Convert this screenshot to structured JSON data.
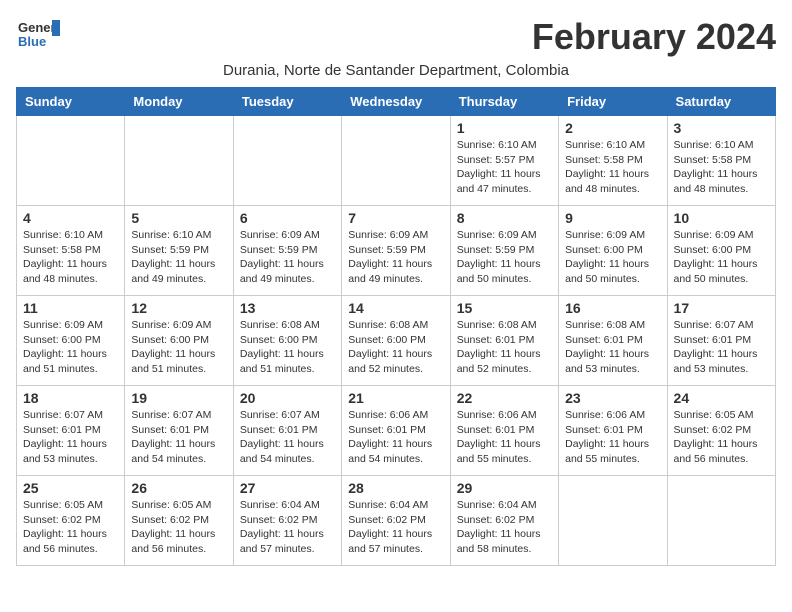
{
  "logo": {
    "general": "General",
    "blue": "Blue"
  },
  "title": "February 2024",
  "subtitle": "Durania, Norte de Santander Department, Colombia",
  "days_of_week": [
    "Sunday",
    "Monday",
    "Tuesday",
    "Wednesday",
    "Thursday",
    "Friday",
    "Saturday"
  ],
  "weeks": [
    [
      {
        "day": "",
        "info": ""
      },
      {
        "day": "",
        "info": ""
      },
      {
        "day": "",
        "info": ""
      },
      {
        "day": "",
        "info": ""
      },
      {
        "day": "1",
        "info": "Sunrise: 6:10 AM\nSunset: 5:57 PM\nDaylight: 11 hours and 47 minutes."
      },
      {
        "day": "2",
        "info": "Sunrise: 6:10 AM\nSunset: 5:58 PM\nDaylight: 11 hours and 48 minutes."
      },
      {
        "day": "3",
        "info": "Sunrise: 6:10 AM\nSunset: 5:58 PM\nDaylight: 11 hours and 48 minutes."
      }
    ],
    [
      {
        "day": "4",
        "info": "Sunrise: 6:10 AM\nSunset: 5:58 PM\nDaylight: 11 hours and 48 minutes."
      },
      {
        "day": "5",
        "info": "Sunrise: 6:10 AM\nSunset: 5:59 PM\nDaylight: 11 hours and 49 minutes."
      },
      {
        "day": "6",
        "info": "Sunrise: 6:09 AM\nSunset: 5:59 PM\nDaylight: 11 hours and 49 minutes."
      },
      {
        "day": "7",
        "info": "Sunrise: 6:09 AM\nSunset: 5:59 PM\nDaylight: 11 hours and 49 minutes."
      },
      {
        "day": "8",
        "info": "Sunrise: 6:09 AM\nSunset: 5:59 PM\nDaylight: 11 hours and 50 minutes."
      },
      {
        "day": "9",
        "info": "Sunrise: 6:09 AM\nSunset: 6:00 PM\nDaylight: 11 hours and 50 minutes."
      },
      {
        "day": "10",
        "info": "Sunrise: 6:09 AM\nSunset: 6:00 PM\nDaylight: 11 hours and 50 minutes."
      }
    ],
    [
      {
        "day": "11",
        "info": "Sunrise: 6:09 AM\nSunset: 6:00 PM\nDaylight: 11 hours and 51 minutes."
      },
      {
        "day": "12",
        "info": "Sunrise: 6:09 AM\nSunset: 6:00 PM\nDaylight: 11 hours and 51 minutes."
      },
      {
        "day": "13",
        "info": "Sunrise: 6:08 AM\nSunset: 6:00 PM\nDaylight: 11 hours and 51 minutes."
      },
      {
        "day": "14",
        "info": "Sunrise: 6:08 AM\nSunset: 6:00 PM\nDaylight: 11 hours and 52 minutes."
      },
      {
        "day": "15",
        "info": "Sunrise: 6:08 AM\nSunset: 6:01 PM\nDaylight: 11 hours and 52 minutes."
      },
      {
        "day": "16",
        "info": "Sunrise: 6:08 AM\nSunset: 6:01 PM\nDaylight: 11 hours and 53 minutes."
      },
      {
        "day": "17",
        "info": "Sunrise: 6:07 AM\nSunset: 6:01 PM\nDaylight: 11 hours and 53 minutes."
      }
    ],
    [
      {
        "day": "18",
        "info": "Sunrise: 6:07 AM\nSunset: 6:01 PM\nDaylight: 11 hours and 53 minutes."
      },
      {
        "day": "19",
        "info": "Sunrise: 6:07 AM\nSunset: 6:01 PM\nDaylight: 11 hours and 54 minutes."
      },
      {
        "day": "20",
        "info": "Sunrise: 6:07 AM\nSunset: 6:01 PM\nDaylight: 11 hours and 54 minutes."
      },
      {
        "day": "21",
        "info": "Sunrise: 6:06 AM\nSunset: 6:01 PM\nDaylight: 11 hours and 54 minutes."
      },
      {
        "day": "22",
        "info": "Sunrise: 6:06 AM\nSunset: 6:01 PM\nDaylight: 11 hours and 55 minutes."
      },
      {
        "day": "23",
        "info": "Sunrise: 6:06 AM\nSunset: 6:01 PM\nDaylight: 11 hours and 55 minutes."
      },
      {
        "day": "24",
        "info": "Sunrise: 6:05 AM\nSunset: 6:02 PM\nDaylight: 11 hours and 56 minutes."
      }
    ],
    [
      {
        "day": "25",
        "info": "Sunrise: 6:05 AM\nSunset: 6:02 PM\nDaylight: 11 hours and 56 minutes."
      },
      {
        "day": "26",
        "info": "Sunrise: 6:05 AM\nSunset: 6:02 PM\nDaylight: 11 hours and 56 minutes."
      },
      {
        "day": "27",
        "info": "Sunrise: 6:04 AM\nSunset: 6:02 PM\nDaylight: 11 hours and 57 minutes."
      },
      {
        "day": "28",
        "info": "Sunrise: 6:04 AM\nSunset: 6:02 PM\nDaylight: 11 hours and 57 minutes."
      },
      {
        "day": "29",
        "info": "Sunrise: 6:04 AM\nSunset: 6:02 PM\nDaylight: 11 hours and 58 minutes."
      },
      {
        "day": "",
        "info": ""
      },
      {
        "day": "",
        "info": ""
      }
    ]
  ]
}
